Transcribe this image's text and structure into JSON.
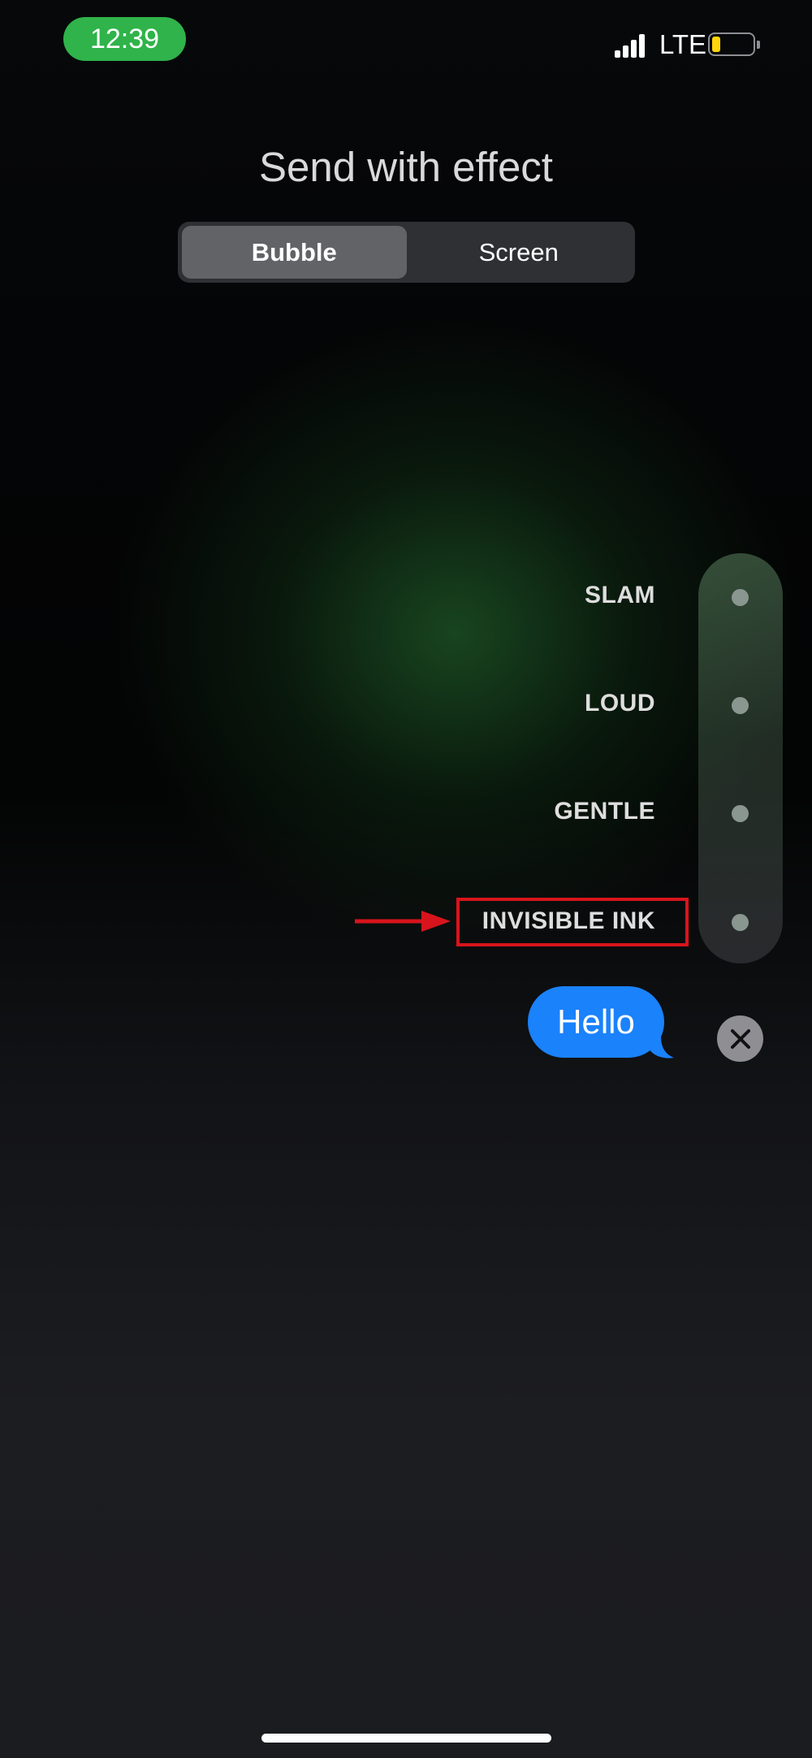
{
  "status_bar": {
    "time": "12:39",
    "network": "LTE",
    "battery_level": 0.15,
    "colors": {
      "time_pill": "#2fb34a",
      "battery_fill": "#ffd60a"
    }
  },
  "title": "Send with effect",
  "tabs": [
    {
      "label": "Bubble",
      "selected": true
    },
    {
      "label": "Screen",
      "selected": false
    }
  ],
  "effects": [
    {
      "label": "SLAM"
    },
    {
      "label": "LOUD"
    },
    {
      "label": "GENTLE"
    },
    {
      "label": "INVISIBLE INK",
      "highlighted": true
    }
  ],
  "message": {
    "text": "Hello",
    "color": "#1a82fb"
  },
  "annotation": {
    "color": "#d8141c",
    "icon": "arrow-right-icon"
  }
}
